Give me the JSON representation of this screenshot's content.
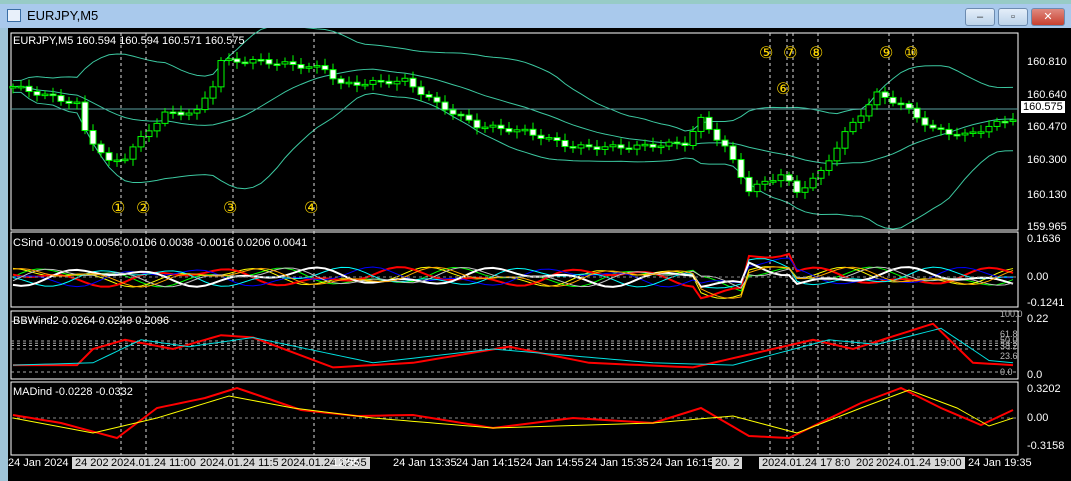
{
  "window": {
    "title": "EURJPY,M5",
    "minimize": "–",
    "maximize": "▫",
    "close": "✕"
  },
  "main": {
    "header": "EURJPY,M5  160.594 160.594 160.571 160.575",
    "current_price": "160.575",
    "price_axis": [
      "160.810",
      "160.640",
      "160.470",
      "160.300",
      "160.130",
      "159.965"
    ],
    "closes_keypoints": [
      [
        0,
        160.69
      ],
      [
        8,
        160.6
      ],
      [
        9,
        160.46
      ],
      [
        12,
        160.3
      ],
      [
        14,
        160.33
      ],
      [
        17,
        160.47
      ],
      [
        19,
        160.55
      ],
      [
        23,
        160.56
      ],
      [
        25,
        160.7
      ],
      [
        26,
        160.82
      ],
      [
        31,
        160.82
      ],
      [
        39,
        160.78
      ],
      [
        41,
        160.7
      ],
      [
        49,
        160.72
      ],
      [
        53,
        160.6
      ],
      [
        58,
        160.49
      ],
      [
        64,
        160.46
      ],
      [
        70,
        160.38
      ],
      [
        77,
        160.38
      ],
      [
        84,
        160.4
      ],
      [
        86,
        160.52
      ],
      [
        89,
        160.38
      ],
      [
        92,
        160.16
      ],
      [
        96,
        160.24
      ],
      [
        98,
        160.15
      ],
      [
        101,
        160.25
      ],
      [
        104,
        160.45
      ],
      [
        106,
        160.55
      ],
      [
        108,
        160.65
      ],
      [
        111,
        160.6
      ],
      [
        115,
        160.47
      ],
      [
        119,
        160.44
      ],
      [
        125,
        160.53
      ]
    ],
    "markers": [
      "①",
      "②",
      "③",
      "④",
      "⑤",
      "⑥",
      "⑦",
      "⑧",
      "⑨",
      "⑩"
    ],
    "colors": {
      "bull": "#00ff00",
      "bear": "#ffffff",
      "bands": "#3cc8a0"
    }
  },
  "csind": {
    "header": "CSind -0.0019 0.0056 0.0106 0.0038 -0.0016 0.0206 0.0041",
    "axis": [
      "0.1636",
      "0.00",
      "-0.1241"
    ]
  },
  "bbwind": {
    "header": "BBWind2 0.0264 0.0249 0.2096",
    "axis": [
      "0.22",
      "0.0"
    ],
    "levels": [
      "100.0",
      "61.8",
      "50.0",
      "38.2",
      "23.6",
      "0.0"
    ],
    "red": [
      [
        0,
        0.03
      ],
      [
        8,
        0.03
      ],
      [
        10,
        0.1
      ],
      [
        14,
        0.14
      ],
      [
        20,
        0.1
      ],
      [
        26,
        0.16
      ],
      [
        30,
        0.15
      ],
      [
        40,
        0.02
      ],
      [
        50,
        0.04
      ],
      [
        62,
        0.11
      ],
      [
        72,
        0.04
      ],
      [
        85,
        0.02
      ],
      [
        95,
        0.1
      ],
      [
        100,
        0.14
      ],
      [
        105,
        0.1
      ],
      [
        115,
        0.21
      ],
      [
        120,
        0.04
      ],
      [
        125,
        0.03
      ]
    ],
    "cyan": [
      [
        0,
        0.03
      ],
      [
        10,
        0.04
      ],
      [
        16,
        0.14
      ],
      [
        22,
        0.11
      ],
      [
        30,
        0.15
      ],
      [
        45,
        0.04
      ],
      [
        60,
        0.1
      ],
      [
        80,
        0.04
      ],
      [
        90,
        0.03
      ],
      [
        102,
        0.14
      ],
      [
        108,
        0.12
      ],
      [
        116,
        0.19
      ],
      [
        122,
        0.05
      ],
      [
        125,
        0.04
      ]
    ]
  },
  "madind": {
    "header": "MADind -0.0228 -0.0332",
    "axis": [
      "0.3202",
      "0.00",
      "-0.3158"
    ],
    "red": [
      [
        0,
        0.03
      ],
      [
        6,
        -0.05
      ],
      [
        13,
        -0.2
      ],
      [
        18,
        0.1
      ],
      [
        24,
        0.2
      ],
      [
        28,
        0.3
      ],
      [
        36,
        0.08
      ],
      [
        43,
        0.02
      ],
      [
        50,
        0.03
      ],
      [
        60,
        -0.1
      ],
      [
        70,
        0.0
      ],
      [
        80,
        -0.05
      ],
      [
        86,
        0.1
      ],
      [
        92,
        -0.18
      ],
      [
        97,
        -0.2
      ],
      [
        106,
        0.15
      ],
      [
        111,
        0.3
      ],
      [
        116,
        0.1
      ],
      [
        121,
        -0.07
      ],
      [
        125,
        0.08
      ]
    ],
    "yellow": [
      [
        0,
        0.0
      ],
      [
        10,
        -0.15
      ],
      [
        18,
        0.0
      ],
      [
        27,
        0.22
      ],
      [
        35,
        0.1
      ],
      [
        45,
        0.0
      ],
      [
        60,
        -0.1
      ],
      [
        80,
        -0.05
      ],
      [
        90,
        0.02
      ],
      [
        98,
        -0.15
      ],
      [
        106,
        0.1
      ],
      [
        112,
        0.28
      ],
      [
        118,
        0.1
      ],
      [
        122,
        -0.08
      ],
      [
        125,
        0.0
      ]
    ]
  },
  "time_axis": [
    "24 Jan 2024",
    "24 2024",
    "2024.01.24 11:00",
    "2024.01.24 11:55",
    "2024.01.24 12:45",
    "12:55",
    "24 Jan 13:35",
    "24 Jan 14:15",
    "24 Jan 14:55",
    "24 Jan 15:35",
    "24 Jan 16:15",
    "20. 2",
    "2024.01.24 17:45",
    "8:0",
    "2024",
    "2024.01.24 19:00",
    "24 Jan 19:35"
  ]
}
